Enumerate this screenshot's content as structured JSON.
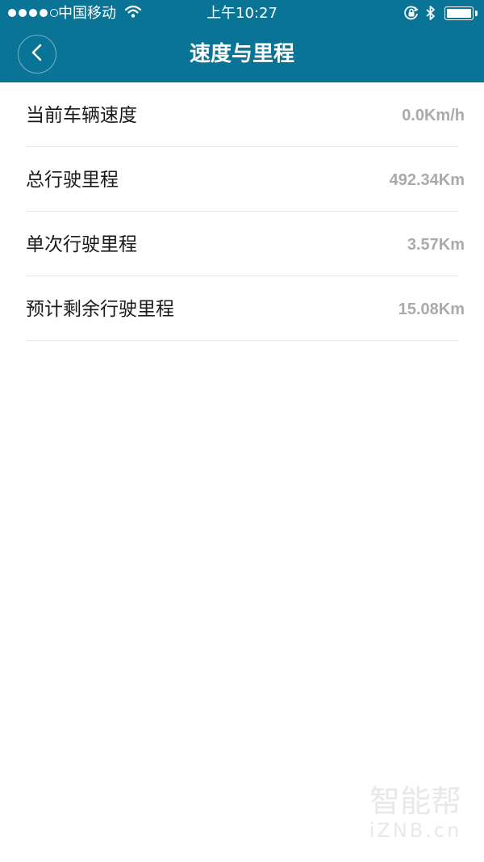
{
  "status_bar": {
    "carrier": "中国移动",
    "time": "上午10:27",
    "signal_bars": 4,
    "signal_max": 5,
    "battery_level": 1.0
  },
  "header": {
    "title": "速度与里程",
    "back_icon": "chevron-left-icon"
  },
  "rows": [
    {
      "label": "当前车辆速度",
      "value": "0.0Km/h"
    },
    {
      "label": "总行驶里程",
      "value": "492.34Km"
    },
    {
      "label": "单次行驶里程",
      "value": "3.57Km"
    },
    {
      "label": "预计剩余行驶里程",
      "value": "15.08Km"
    }
  ],
  "watermark": {
    "cn": "智能帮",
    "en": "iZNB.cn"
  },
  "colors": {
    "accent": "#0a7497",
    "label": "#1a1a1a",
    "value": "#aaaaaa",
    "divider": "#e6e6e6"
  }
}
